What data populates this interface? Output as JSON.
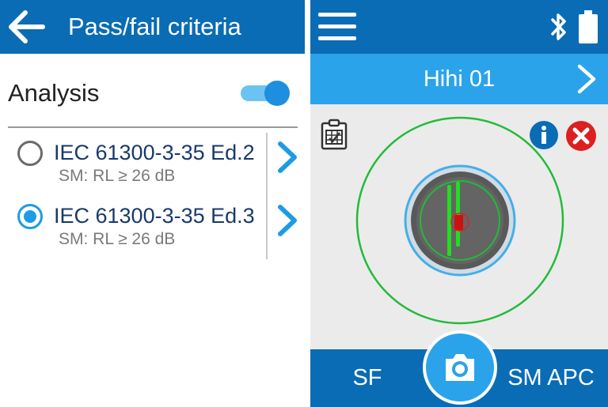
{
  "left_panel": {
    "title": "Pass/fail criteria",
    "analysis": {
      "label": "Analysis",
      "enabled": true
    },
    "criteria": [
      {
        "name": "IEC 61300-3-35 Ed.2",
        "subtitle": "SM: RL ≥ 26 dB",
        "selected": false
      },
      {
        "name": "IEC 61300-3-35 Ed.3",
        "subtitle": "SM: RL ≥ 26 dB",
        "selected": true
      }
    ]
  },
  "right_panel": {
    "device_name": "Hihi 01",
    "bottom_left_label": "SF",
    "bottom_right_label": "SM APC"
  },
  "icons": {
    "back": "arrow-left-icon",
    "menu": "hamburger-menu-icon",
    "bluetooth": "bluetooth-icon",
    "battery": "battery-icon",
    "report": "clipboard-report-icon",
    "info": "info-icon",
    "close": "close-icon",
    "camera": "camera-icon",
    "chevron": "chevron-right-icon"
  },
  "colors": {
    "header_blue": "#0a6cb5",
    "accent_blue": "#2ba3ea",
    "radio_blue": "#1e9be4",
    "toggle_track": "#6cc3f2",
    "zone_green": "#22bb3a",
    "zone_blue": "#45aee8",
    "defect_red": "#cc1111"
  }
}
